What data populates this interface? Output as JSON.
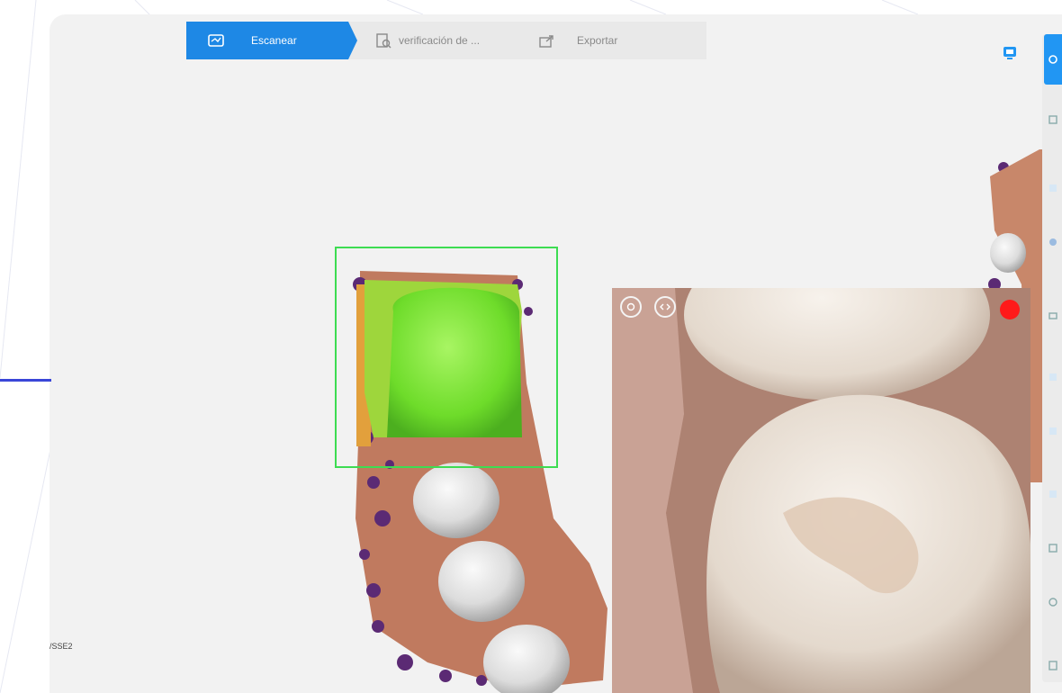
{
  "workflow": {
    "steps": [
      {
        "label": "Escanear",
        "icon": "scan-icon",
        "state": "active"
      },
      {
        "label": "verificación de ...",
        "icon": "verify-icon",
        "state": "inactive"
      },
      {
        "label": "Exportar",
        "icon": "export-icon",
        "state": "inactive"
      }
    ]
  },
  "viewport": {
    "tooth_label": "/SSE2"
  },
  "toolbar": {
    "icons": [
      "view-icon",
      "scan-mode-icon",
      "tool-icon",
      "brush-icon",
      "lock-icon",
      "tool-icon",
      "tool-icon",
      "tool-icon",
      "tool-icon",
      "copy-icon",
      "search-icon",
      "document-icon"
    ]
  },
  "colors": {
    "accent": "#1e88e5",
    "scan_frame": "#3ddc52",
    "record": "#ff1a1a",
    "background": "#f2f2f2"
  }
}
